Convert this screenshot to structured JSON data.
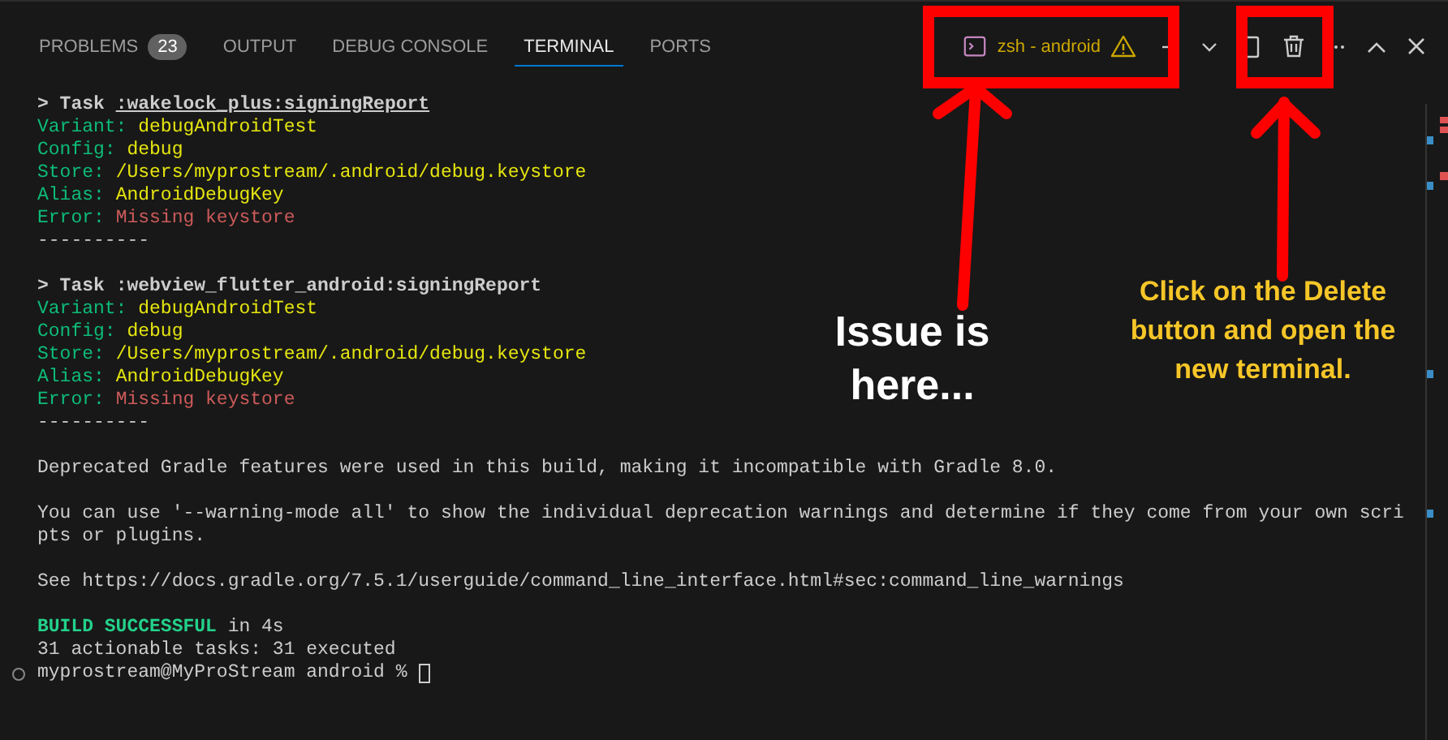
{
  "panel_tabs": [
    {
      "label": "PROBLEMS",
      "badge": "23",
      "selected": false
    },
    {
      "label": "OUTPUT",
      "selected": false
    },
    {
      "label": "DEBUG CONSOLE",
      "selected": false
    },
    {
      "label": "TERMINAL",
      "selected": true
    },
    {
      "label": "PORTS",
      "selected": false
    }
  ],
  "terminal_selector": {
    "label": "zsh - android",
    "warning": true
  },
  "terminal_blocks": [
    [
      {
        "kind": "task",
        "prefix": "> Task ",
        "name": ":wakelock_plus:signingReport",
        "underlined": true
      },
      {
        "kind": "field",
        "label": "Variant: ",
        "value": "debugAndroidTest"
      },
      {
        "kind": "field",
        "label": "Config: ",
        "value": "debug"
      },
      {
        "kind": "field",
        "label": "Store: ",
        "value": "/Users/myprostream/.android/debug.keystore"
      },
      {
        "kind": "field",
        "label": "Alias: ",
        "value": "AndroidDebugKey"
      },
      {
        "kind": "error",
        "label": "Error: ",
        "value": "Missing keystore"
      },
      {
        "kind": "plain",
        "text": "----------"
      }
    ],
    [
      {
        "kind": "task",
        "prefix": "> Task ",
        "name": ":webview_flutter_android:signingReport",
        "underlined": false
      },
      {
        "kind": "field",
        "label": "Variant: ",
        "value": "debugAndroidTest"
      },
      {
        "kind": "field",
        "label": "Config: ",
        "value": "debug"
      },
      {
        "kind": "field",
        "label": "Store: ",
        "value": "/Users/myprostream/.android/debug.keystore"
      },
      {
        "kind": "field",
        "label": "Alias: ",
        "value": "AndroidDebugKey"
      },
      {
        "kind": "error",
        "label": "Error: ",
        "value": "Missing keystore"
      },
      {
        "kind": "plain",
        "text": "----------"
      }
    ],
    [
      {
        "kind": "plain",
        "text": "Deprecated Gradle features were used in this build, making it incompatible with Gradle 8.0."
      }
    ],
    [
      {
        "kind": "plain",
        "text": "You can use '--warning-mode all' to show the individual deprecation warnings and determine if they come from your own scri"
      },
      {
        "kind": "plain",
        "text": "pts or plugins."
      }
    ],
    [
      {
        "kind": "plain",
        "text": "See https://docs.gradle.org/7.5.1/userguide/command_line_interface.html#sec:command_line_warnings"
      }
    ],
    [
      {
        "kind": "success",
        "label": "BUILD SUCCESSFUL",
        "value": " in 4s"
      },
      {
        "kind": "plain",
        "text": "31 actionable tasks: 31 executed"
      },
      {
        "kind": "prompt",
        "text": "myprostream@MyProStream android % "
      }
    ]
  ],
  "annotations": {
    "issue_note": "Issue is here...",
    "delete_note": "Click on the Delete button and open the new terminal."
  }
}
